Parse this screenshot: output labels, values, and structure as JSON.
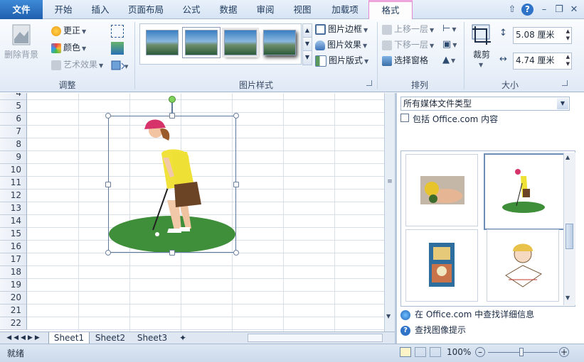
{
  "tabs": [
    "文件",
    "开始",
    "插入",
    "页面布局",
    "公式",
    "数据",
    "审阅",
    "视图",
    "加载项",
    "格式"
  ],
  "adjust": {
    "remove_bg": "删除背景",
    "corrections": "更正",
    "color": "颜色",
    "artistic": "艺术效果",
    "group_label": "调整"
  },
  "picture_styles": {
    "border": "图片边框",
    "effects": "图片效果",
    "layout": "图片版式",
    "group_label": "图片样式"
  },
  "arrange": {
    "bring_forward": "上移一层",
    "send_backward": "下移一层",
    "selection_pane": "选择窗格",
    "group_label": "排列"
  },
  "size": {
    "crop": "裁剪",
    "height": "5.08 厘米",
    "width": "4.74 厘米",
    "group_label": "大小"
  },
  "rows": [
    "4",
    "5",
    "6",
    "7",
    "8",
    "9",
    "10",
    "11",
    "12",
    "13",
    "14",
    "15",
    "16",
    "17",
    "18",
    "19",
    "20",
    "21",
    "22"
  ],
  "sheet_tabs": [
    "Sheet1",
    "Sheet2",
    "Sheet3"
  ],
  "status": {
    "ready": "就绪",
    "zoom": "100%"
  },
  "clipart": {
    "media_type": "所有媒体文件类型",
    "include_office": "包括 Office.com 内容",
    "more_info": "在 Office.com 中查找详细信息",
    "find_tips": "查找图像提示"
  },
  "colors": {
    "accent": "#1f5fae",
    "format_tab": "#e586d0",
    "grass": "#3f8f3a"
  }
}
